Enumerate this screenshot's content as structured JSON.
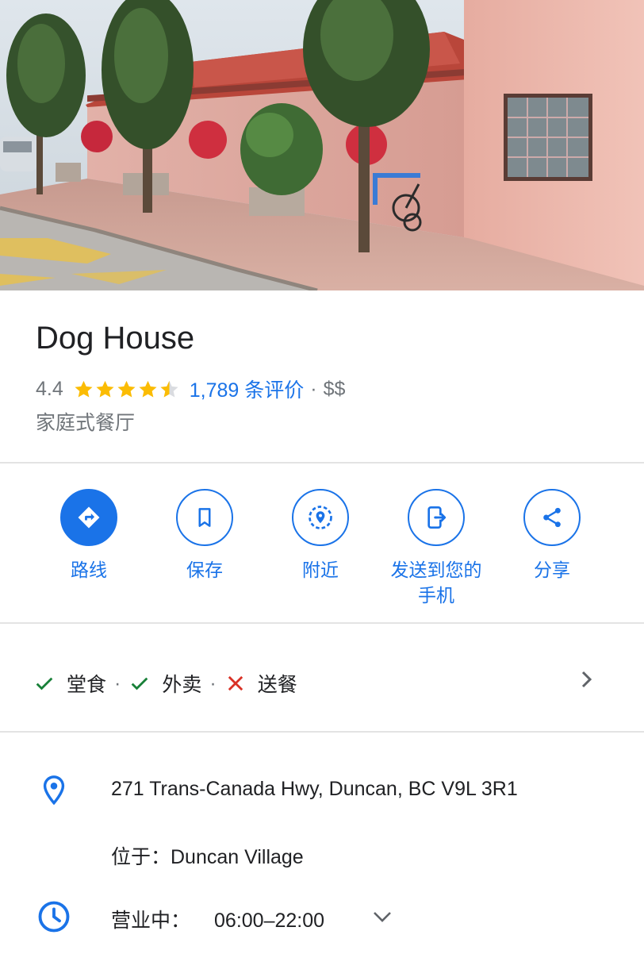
{
  "place": {
    "name": "Dog House",
    "rating": "4.4",
    "rating_value": 4.4,
    "reviews": "1,789 条评价",
    "separator": "·",
    "price": "$$",
    "category": "家庭式餐厅"
  },
  "actions": [
    {
      "label": "路线",
      "icon": "directions-icon"
    },
    {
      "label": "保存",
      "icon": "bookmark-icon"
    },
    {
      "label": "附近",
      "icon": "nearby-icon"
    },
    {
      "label": "发送到您的手机",
      "icon": "send-to-phone-icon"
    },
    {
      "label": "分享",
      "icon": "share-icon"
    }
  ],
  "services": {
    "items": [
      {
        "label": "堂食",
        "available": true
      },
      {
        "label": "外卖",
        "available": true
      },
      {
        "label": "送餐",
        "available": false
      }
    ],
    "separator": "·"
  },
  "info": {
    "address": "271 Trans-Canada Hwy, Duncan, BC V9L 3R1",
    "located_in": "位于：Duncan Village",
    "hours_status": "营业中：",
    "hours": "06:00–22:00"
  },
  "colors": {
    "accent": "#1a73e8",
    "star": "#fbbc04",
    "check": "#188038",
    "cross": "#d93025",
    "text_secondary": "#70757a"
  }
}
